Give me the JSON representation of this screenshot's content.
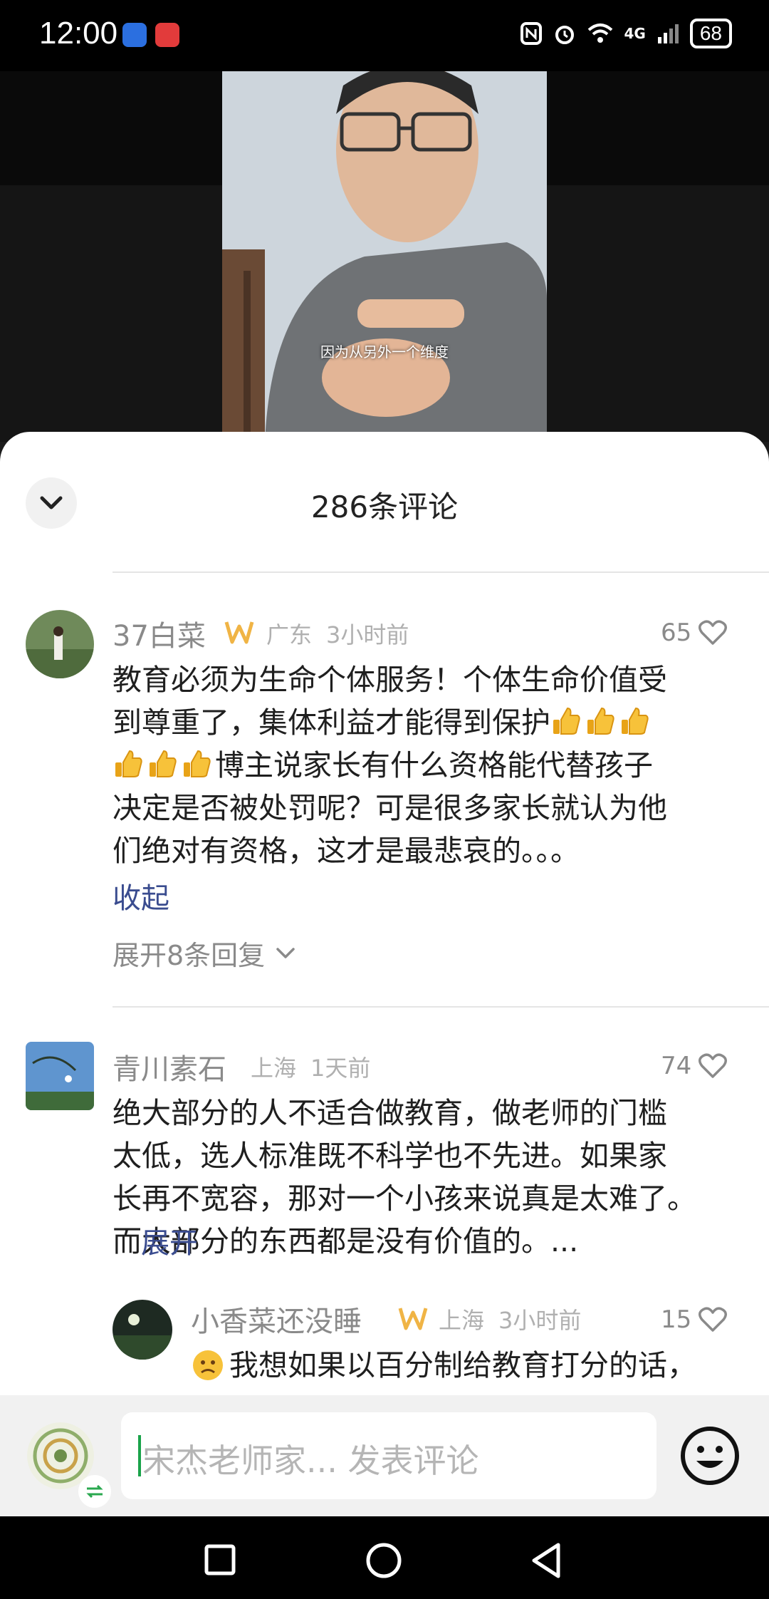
{
  "status_bar": {
    "time": "12:00",
    "battery": "68",
    "network": "4G"
  },
  "video": {
    "subtitle": "因为从另外一个维度"
  },
  "sheet": {
    "title": "286条评论"
  },
  "comments": [
    {
      "username": "37白菜",
      "location": "广东",
      "time": "3小时前",
      "likes": "65",
      "lines": [
        "教育必须为生命个体服务！个体生命价值受",
        "到尊重了，集体利益才能得到保护",
        "博主说家长有什么资格能代替孩子",
        "决定是否被处罚呢？可是很多家长就认为他",
        "们绝对有资格，这才是最悲哀的。。。"
      ],
      "collapse_label": "收起",
      "expand_replies_label": "展开8条回复"
    },
    {
      "username": "青川素石",
      "location": "上海",
      "time": "1天前",
      "likes": "74",
      "lines": [
        "绝大部分的人不适合做教育，做老师的门槛",
        "太低，选人标准既不科学也不先进。如果家",
        "长再不宽容，那对一个小孩来说真是太难了。",
        "而大部分的东西都是没有价值的。..."
      ],
      "expand_label": "展开"
    },
    {
      "username": "小香菜还没睡",
      "location": "上海",
      "time": "3小时前",
      "likes": "15",
      "lines": [
        "我想如果以百分制给教育打分的话，"
      ]
    }
  ],
  "input": {
    "placeholder": "宋杰老师家... 发表评论"
  },
  "colors": {
    "link": "#3a4c8f",
    "badge": "#f0b445",
    "caret": "#1aa34a"
  },
  "icons": [
    "chevron-down-icon",
    "heart-icon",
    "vip-badge-icon",
    "emoji-icon",
    "switch-account-icon",
    "square-nav-icon",
    "circle-nav-icon",
    "back-nav-icon"
  ]
}
